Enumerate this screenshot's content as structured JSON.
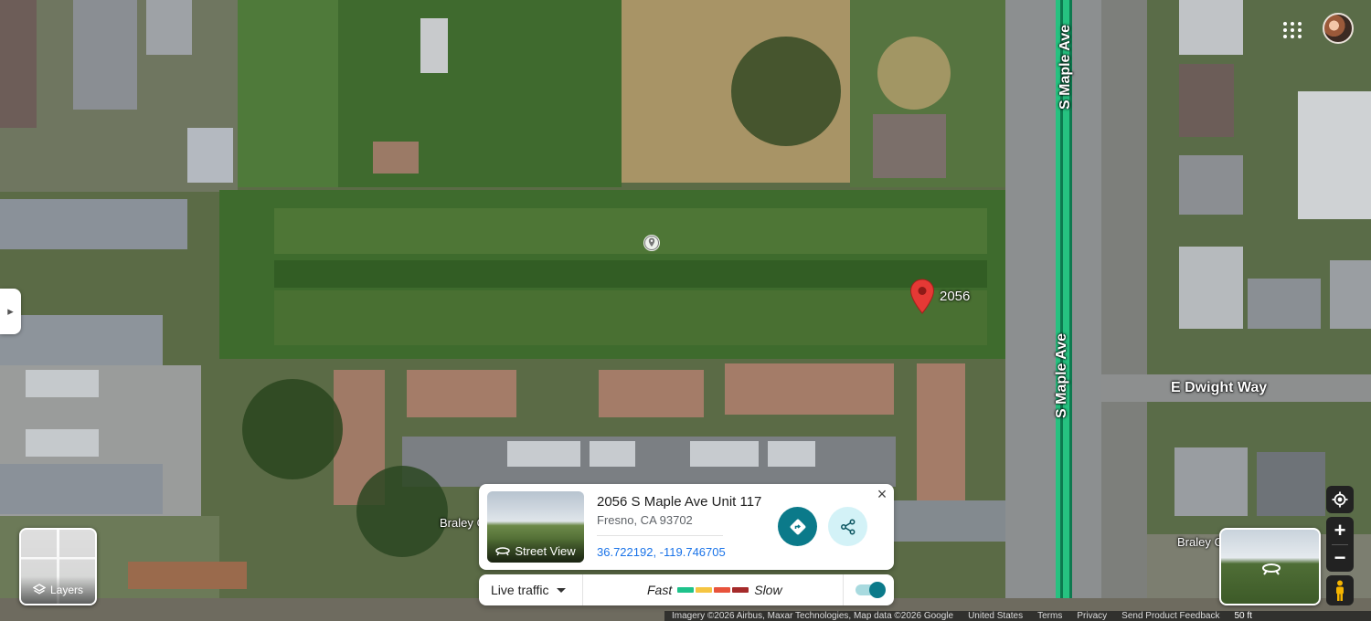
{
  "map": {
    "roads": {
      "maple_upper": "S Maple Ave",
      "maple_lower": "S Maple Ave",
      "dwight": "E Dwight Way"
    },
    "places": {
      "braley_left": "Braley C",
      "braley_right": "Braley C"
    },
    "pin_label": "2056",
    "marker_color": "#e53935"
  },
  "header": {
    "apps_icon": "apps-grid-icon",
    "avatar_icon": "account-avatar"
  },
  "layers": {
    "label": "Layers"
  },
  "place_card": {
    "street_view_label": "Street View",
    "title": "2056 S Maple Ave Unit 117",
    "subtitle": "Fresno, CA 93702",
    "coordinates": "36.722192, -119.746705",
    "directions_icon": "directions-icon",
    "share_icon": "share-icon",
    "close_icon": "close-icon",
    "accent": "#0b7a8a"
  },
  "traffic": {
    "live_label": "Live traffic",
    "fast_label": "Fast",
    "slow_label": "Slow",
    "colors": [
      "#1ec28b",
      "#f5c542",
      "#e8533c",
      "#a52a2a"
    ],
    "enabled": true
  },
  "controls": {
    "locate_icon": "my-location-icon",
    "zoom_in": "+",
    "zoom_out": "−",
    "pegman_icon": "pegman-icon"
  },
  "footer": {
    "imagery": "Imagery ©2026 Airbus, Maxar Technologies, Map data ©2026 Google",
    "country": "United States",
    "terms": "Terms",
    "privacy": "Privacy",
    "feedback": "Send Product Feedback",
    "scale": "50 ft"
  }
}
